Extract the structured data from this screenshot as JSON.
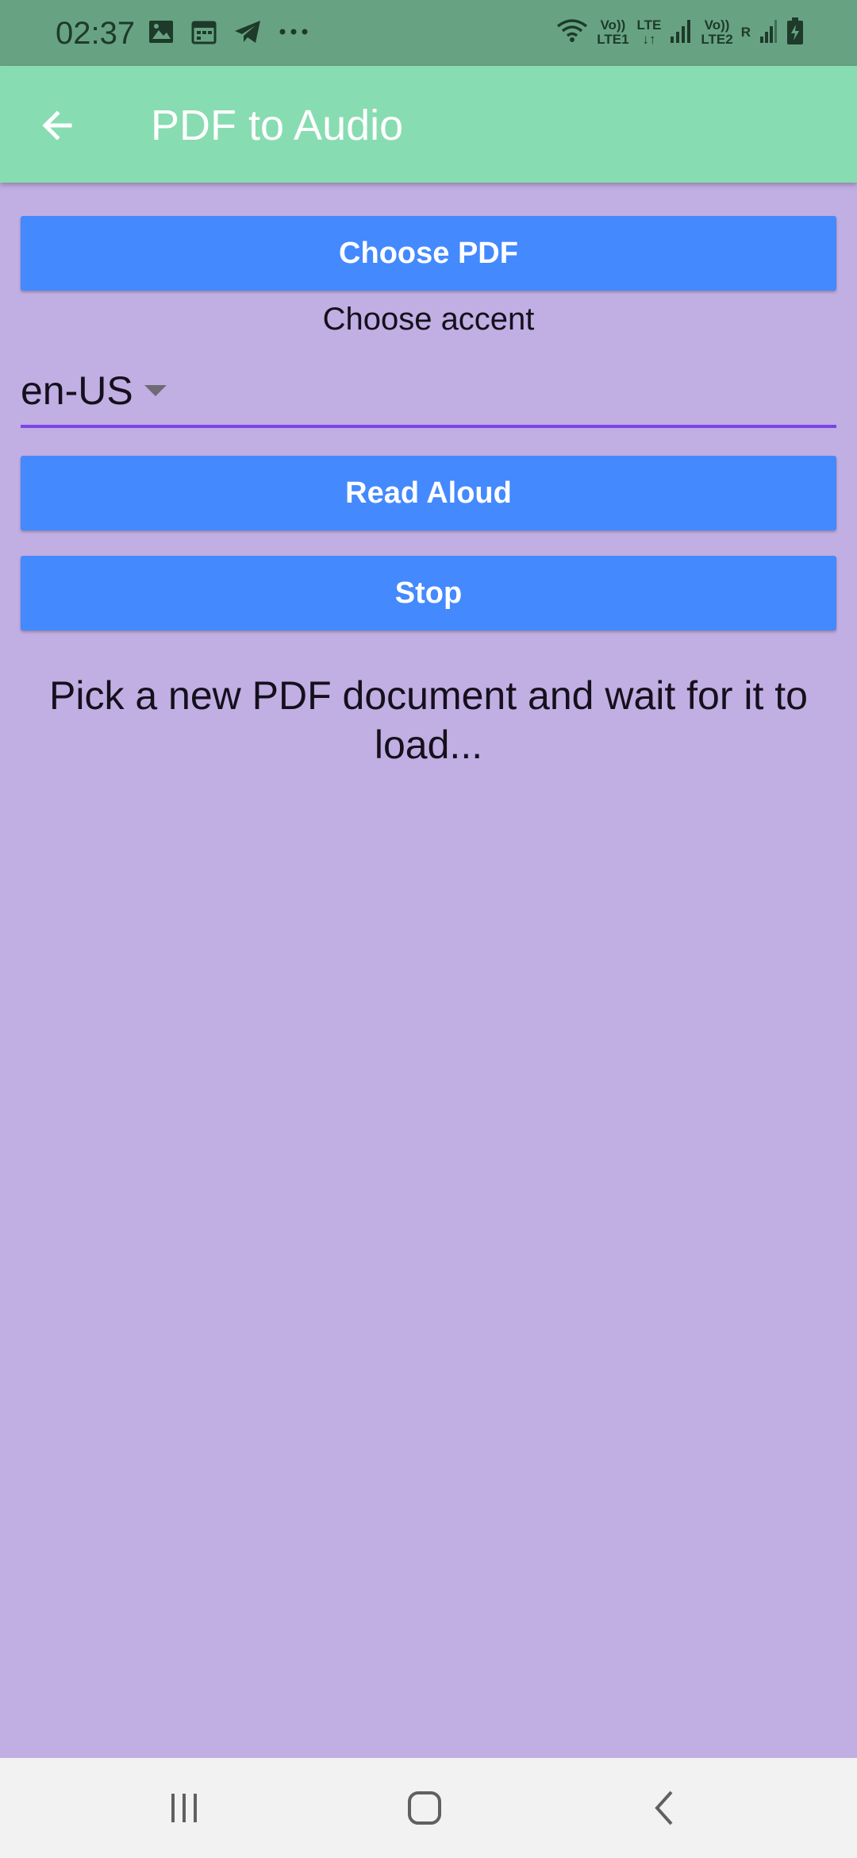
{
  "status_bar": {
    "time": "02:37",
    "left_icons": [
      "image-icon",
      "calendar-icon",
      "telegram-icon",
      "more-dots-icon"
    ],
    "sim1_label_top": "Vo))",
    "sim1_label_bottom": "LTE1",
    "lte_label": "LTE",
    "sim2_label_top": "Vo))",
    "sim2_label_bottom": "LTE2",
    "roaming_label": "R"
  },
  "app_bar": {
    "title": "PDF to Audio",
    "back_icon": "arrow-left-icon"
  },
  "main": {
    "choose_pdf_label": "Choose PDF",
    "accent_label": "Choose accent",
    "accent_dropdown": {
      "selected": "en-US"
    },
    "read_aloud_label": "Read Aloud",
    "stop_label": "Stop",
    "message": "Pick a new PDF document and wait for it to load..."
  },
  "nav_bar": {
    "items": [
      "recents-icon",
      "home-icon",
      "back-icon"
    ]
  },
  "colors": {
    "status_bar": "#67a383",
    "app_bar": "#88dcb1",
    "background": "#c1aee3",
    "button": "#4489fe",
    "dropdown_underline": "#7b45e6",
    "nav_bar": "#f2f2f2"
  }
}
